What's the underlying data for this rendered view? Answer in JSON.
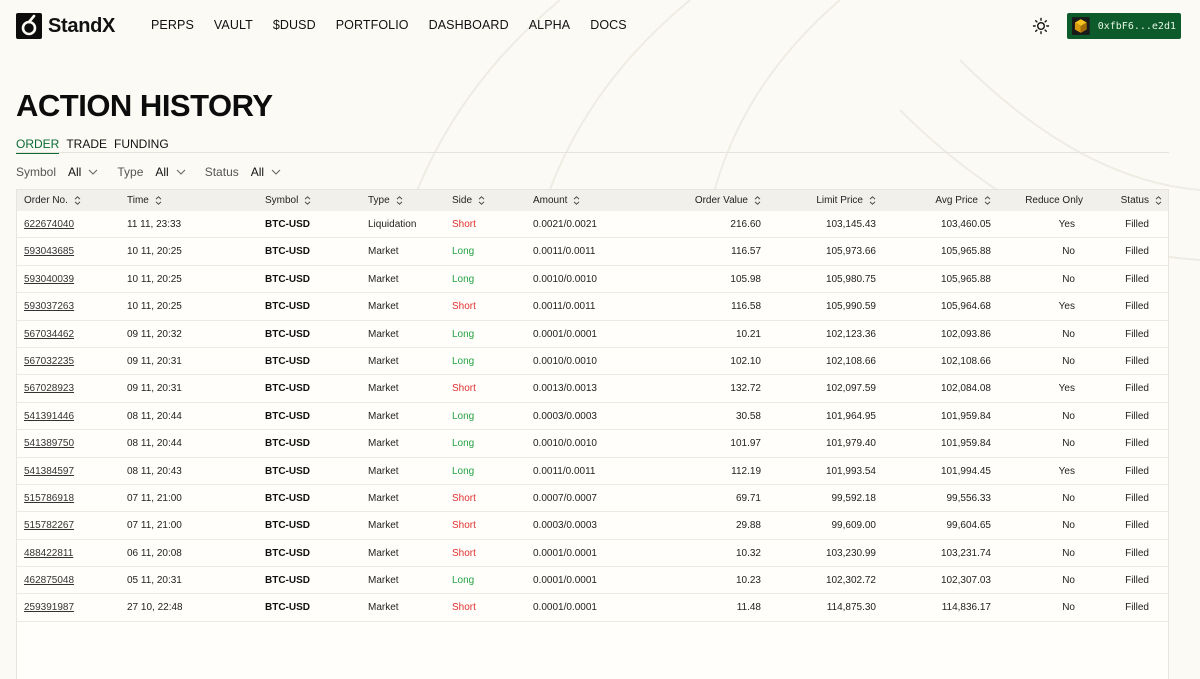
{
  "brand": {
    "name": "StandX"
  },
  "nav": [
    "PERPS",
    "VAULT",
    "$DUSD",
    "PORTFOLIO",
    "DASHBOARD",
    "ALPHA",
    "DOCS"
  ],
  "wallet": {
    "address": "0xfbF6...e2d1"
  },
  "page": {
    "title": "ACTION HISTORY"
  },
  "tabs": [
    {
      "label": "ORDER",
      "active": true
    },
    {
      "label": "TRADE",
      "active": false
    },
    {
      "label": "FUNDING",
      "active": false
    }
  ],
  "filters": [
    {
      "label": "Symbol",
      "value": "All"
    },
    {
      "label": "Type",
      "value": "All"
    },
    {
      "label": "Status",
      "value": "All"
    }
  ],
  "table": {
    "columns": [
      "Order No.",
      "Time",
      "Symbol",
      "Type",
      "Side",
      "Amount",
      "Order Value",
      "Limit Price",
      "Avg Price",
      "Reduce Only",
      "Status"
    ],
    "rows": [
      [
        "622674040",
        "11 11, 23:33",
        "BTC-USD",
        "Liquidation",
        "Short",
        "0.0021/0.0021",
        "216.60",
        "103,145.43",
        "103,460.05",
        "Yes",
        "Filled"
      ],
      [
        "593043685",
        "10 11, 20:25",
        "BTC-USD",
        "Market",
        "Long",
        "0.0011/0.0011",
        "116.57",
        "105,973.66",
        "105,965.88",
        "No",
        "Filled"
      ],
      [
        "593040039",
        "10 11, 20:25",
        "BTC-USD",
        "Market",
        "Long",
        "0.0010/0.0010",
        "105.98",
        "105,980.75",
        "105,965.88",
        "No",
        "Filled"
      ],
      [
        "593037263",
        "10 11, 20:25",
        "BTC-USD",
        "Market",
        "Short",
        "0.0011/0.0011",
        "116.58",
        "105,990.59",
        "105,964.68",
        "Yes",
        "Filled"
      ],
      [
        "567034462",
        "09 11, 20:32",
        "BTC-USD",
        "Market",
        "Long",
        "0.0001/0.0001",
        "10.21",
        "102,123.36",
        "102,093.86",
        "No",
        "Filled"
      ],
      [
        "567032235",
        "09 11, 20:31",
        "BTC-USD",
        "Market",
        "Long",
        "0.0010/0.0010",
        "102.10",
        "102,108.66",
        "102,108.66",
        "No",
        "Filled"
      ],
      [
        "567028923",
        "09 11, 20:31",
        "BTC-USD",
        "Market",
        "Short",
        "0.0013/0.0013",
        "132.72",
        "102,097.59",
        "102,084.08",
        "Yes",
        "Filled"
      ],
      [
        "541391446",
        "08 11, 20:44",
        "BTC-USD",
        "Market",
        "Long",
        "0.0003/0.0003",
        "30.58",
        "101,964.95",
        "101,959.84",
        "No",
        "Filled"
      ],
      [
        "541389750",
        "08 11, 20:44",
        "BTC-USD",
        "Market",
        "Long",
        "0.0010/0.0010",
        "101.97",
        "101,979.40",
        "101,959.84",
        "No",
        "Filled"
      ],
      [
        "541384597",
        "08 11, 20:43",
        "BTC-USD",
        "Market",
        "Long",
        "0.0011/0.0011",
        "112.19",
        "101,993.54",
        "101,994.45",
        "Yes",
        "Filled"
      ],
      [
        "515786918",
        "07 11, 21:00",
        "BTC-USD",
        "Market",
        "Short",
        "0.0007/0.0007",
        "69.71",
        "99,592.18",
        "99,556.33",
        "No",
        "Filled"
      ],
      [
        "515782267",
        "07 11, 21:00",
        "BTC-USD",
        "Market",
        "Short",
        "0.0003/0.0003",
        "29.88",
        "99,609.00",
        "99,604.65",
        "No",
        "Filled"
      ],
      [
        "488422811",
        "06 11, 20:08",
        "BTC-USD",
        "Market",
        "Short",
        "0.0001/0.0001",
        "10.32",
        "103,230.99",
        "103,231.74",
        "No",
        "Filled"
      ],
      [
        "462875048",
        "05 11, 20:31",
        "BTC-USD",
        "Market",
        "Long",
        "0.0001/0.0001",
        "10.23",
        "102,302.72",
        "102,307.03",
        "No",
        "Filled"
      ],
      [
        "259391987",
        "27 10, 22:48",
        "BTC-USD",
        "Market",
        "Short",
        "0.0001/0.0001",
        "11.48",
        "114,875.30",
        "114,836.17",
        "No",
        "Filled"
      ]
    ]
  },
  "colors": {
    "accent": "#0d6b35",
    "long": "#25a244",
    "short": "#e0302f",
    "wallet_bg": "#0d5a2a"
  },
  "icons": {
    "theme": "sun-icon",
    "sort": "sort-updown-icon",
    "dropdown": "chevron-down-icon"
  }
}
